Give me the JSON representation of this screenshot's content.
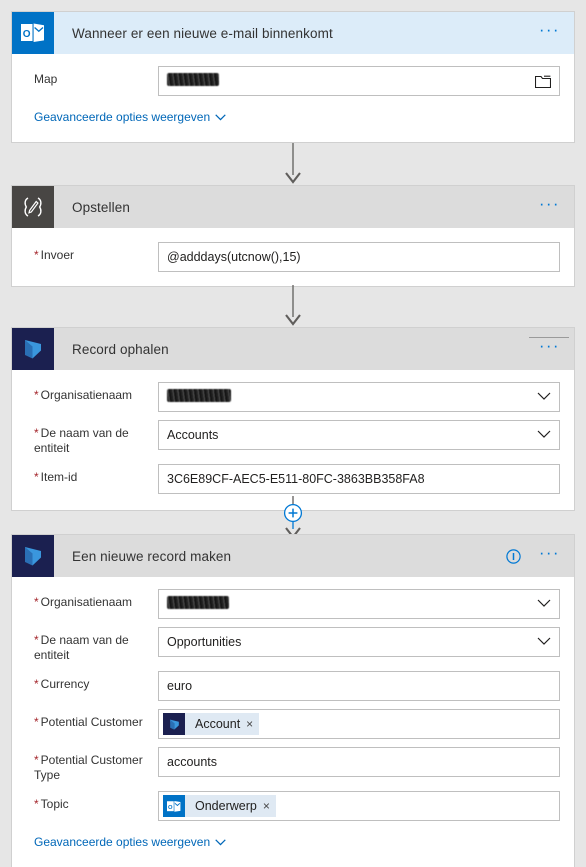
{
  "app": {
    "title": "Power Automate flow designer",
    "accent_color": "#0078d4",
    "required_marker": "*",
    "link_color": "#0067b8"
  },
  "cards": [
    {
      "id": "trigger-new-email",
      "title": "Wanneer er een nieuwe e-mail binnenkomt",
      "icon": "outlook-icon",
      "header_style": "blue",
      "ellipsis_label": "···",
      "fields": [
        {
          "label": "Map",
          "required": false,
          "value": "",
          "redacted": true,
          "redacted_width": 52,
          "control": "folder-picker"
        }
      ],
      "advanced_link": "Geavanceerde opties weergeven"
    },
    {
      "id": "compose",
      "title": "Opstellen",
      "icon": "compose-icon",
      "header_style": "gray",
      "ellipsis_label": "···",
      "fields": [
        {
          "label": "Invoer",
          "required": true,
          "value": "@adddays(utcnow(),15)",
          "redacted": false,
          "control": "text"
        }
      ],
      "advanced_link": null
    },
    {
      "id": "get-record",
      "title": "Record ophalen",
      "icon": "dynamics-icon",
      "header_style": "gray",
      "ellipsis_label": "···",
      "fields": [
        {
          "label": "Organisatienaam",
          "required": true,
          "value": "",
          "redacted": true,
          "redacted_width": 64,
          "control": "dropdown"
        },
        {
          "label": "De naam van de entiteit",
          "required": true,
          "value": "Accounts",
          "redacted": false,
          "control": "dropdown"
        },
        {
          "label": "Item-id",
          "required": true,
          "value": "3C6E89CF-AEC5-E511-80FC-3863BB358FA8",
          "redacted": false,
          "control": "text"
        }
      ],
      "advanced_link": null
    },
    {
      "id": "create-new-record",
      "title": "Een nieuwe record maken",
      "icon": "dynamics-icon",
      "header_style": "gray",
      "info_icon": "info-icon",
      "ellipsis_label": "···",
      "fields": [
        {
          "label": "Organisatienaam",
          "required": true,
          "value": "",
          "redacted": true,
          "redacted_width": 62,
          "control": "dropdown"
        },
        {
          "label": "De naam van de entiteit",
          "required": true,
          "value": "Opportunities",
          "redacted": false,
          "control": "dropdown"
        },
        {
          "label": "Currency",
          "required": true,
          "value": "euro",
          "redacted": false,
          "control": "text"
        },
        {
          "label": "Potential Customer",
          "required": true,
          "value": "",
          "redacted": false,
          "control": "token",
          "token": {
            "label": "Account",
            "icon": "dynamics-icon",
            "remove": "×"
          }
        },
        {
          "label": "Potential Customer Type",
          "required": true,
          "value": "accounts",
          "redacted": false,
          "control": "text"
        },
        {
          "label": "Topic",
          "required": true,
          "value": "",
          "redacted": false,
          "control": "token",
          "token": {
            "label": "Onderwerp",
            "icon": "outlook-icon",
            "remove": "×"
          }
        }
      ],
      "advanced_link": "Geavanceerde opties weergeven"
    }
  ],
  "connectors": [
    {
      "type": "arrow",
      "after": "trigger-new-email"
    },
    {
      "type": "arrow",
      "after": "compose"
    },
    {
      "type": "insert-arrow",
      "after": "get-record",
      "insert_label": "+"
    }
  ]
}
